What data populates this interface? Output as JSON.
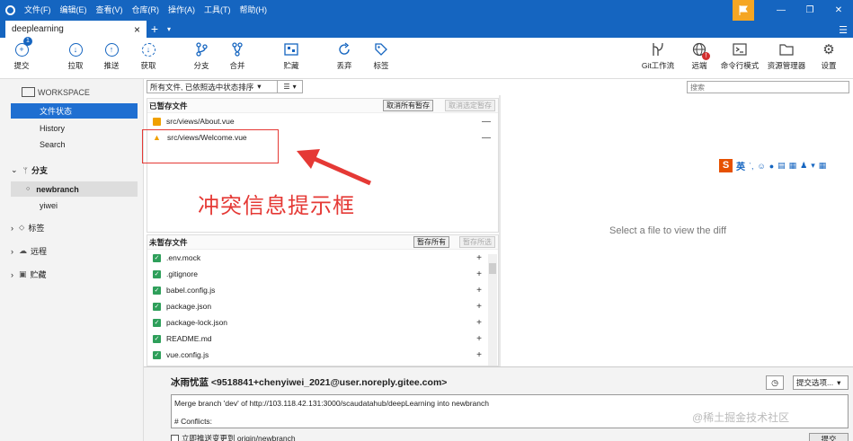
{
  "menu": [
    "文件(F)",
    "编辑(E)",
    "查看(V)",
    "仓库(R)",
    "操作(A)",
    "工具(T)",
    "帮助(H)"
  ],
  "tab": {
    "label": "deeplearning",
    "close": "×",
    "add": "+",
    "menu": "▾"
  },
  "toolbar": {
    "commit": "提交",
    "commit_badge": "1",
    "pull": "拉取",
    "push": "推送",
    "fetch": "获取",
    "branch": "分支",
    "merge": "合并",
    "stash": "贮藏",
    "discard": "丢弃",
    "tag": "标签",
    "gitflow": "Git工作流",
    "remote": "远端",
    "remote_badge": "!",
    "terminal": "命令行模式",
    "explorer": "资源管理器",
    "settings": "设置"
  },
  "sidebar": {
    "workspace": "WORKSPACE",
    "file_status": "文件状态",
    "history": "History",
    "search": "Search",
    "branches": "分支",
    "branch_items": [
      "newbranch",
      "yiwei"
    ],
    "tags": "标签",
    "remotes": "远程",
    "stashes": "贮藏"
  },
  "filter": {
    "label": "所有文件, 已依照选中状态排序",
    "view": "☰"
  },
  "search": {
    "placeholder": "搜索"
  },
  "staged": {
    "title": "已暂存文件",
    "unstage_all": "取消所有暂存",
    "unstage_selected": "取消选定暂存",
    "files": [
      "src/views/About.vue",
      "src/views/Welcome.vue"
    ]
  },
  "unstaged": {
    "title": "未暂存文件",
    "stage_all": "暂存所有",
    "stage_selected": "暂存所选",
    "files": [
      ".env.mock",
      ".gitignore",
      "babel.config.js",
      "package.json",
      "package-lock.json",
      "README.md",
      "vue.config.js"
    ]
  },
  "annotation": {
    "text": "冲突信息提示框"
  },
  "diff": {
    "empty": "Select a file to view the diff"
  },
  "commit": {
    "author": "冰雨忧蓝 <9518841+chenyiwei_2021@user.noreply.gitee.com>",
    "options": "提交选项...",
    "message_line1": "Merge branch 'dev' of http://103.118.42.131:3000/scaudatahub/deepLearning into newbranch",
    "message_line2": "# Conflicts:",
    "push_now": "立即推送变更到 origin/newbranch",
    "submit": "提交"
  },
  "ime": {
    "mode": "英"
  },
  "watermark": "@稀土掘金技术社区",
  "colors": {
    "brand": "#1565c0",
    "selection": "#1f6fd1",
    "conflict": "#f0a000",
    "staged_check": "#2e9f5a",
    "annotation": "#e53935"
  }
}
